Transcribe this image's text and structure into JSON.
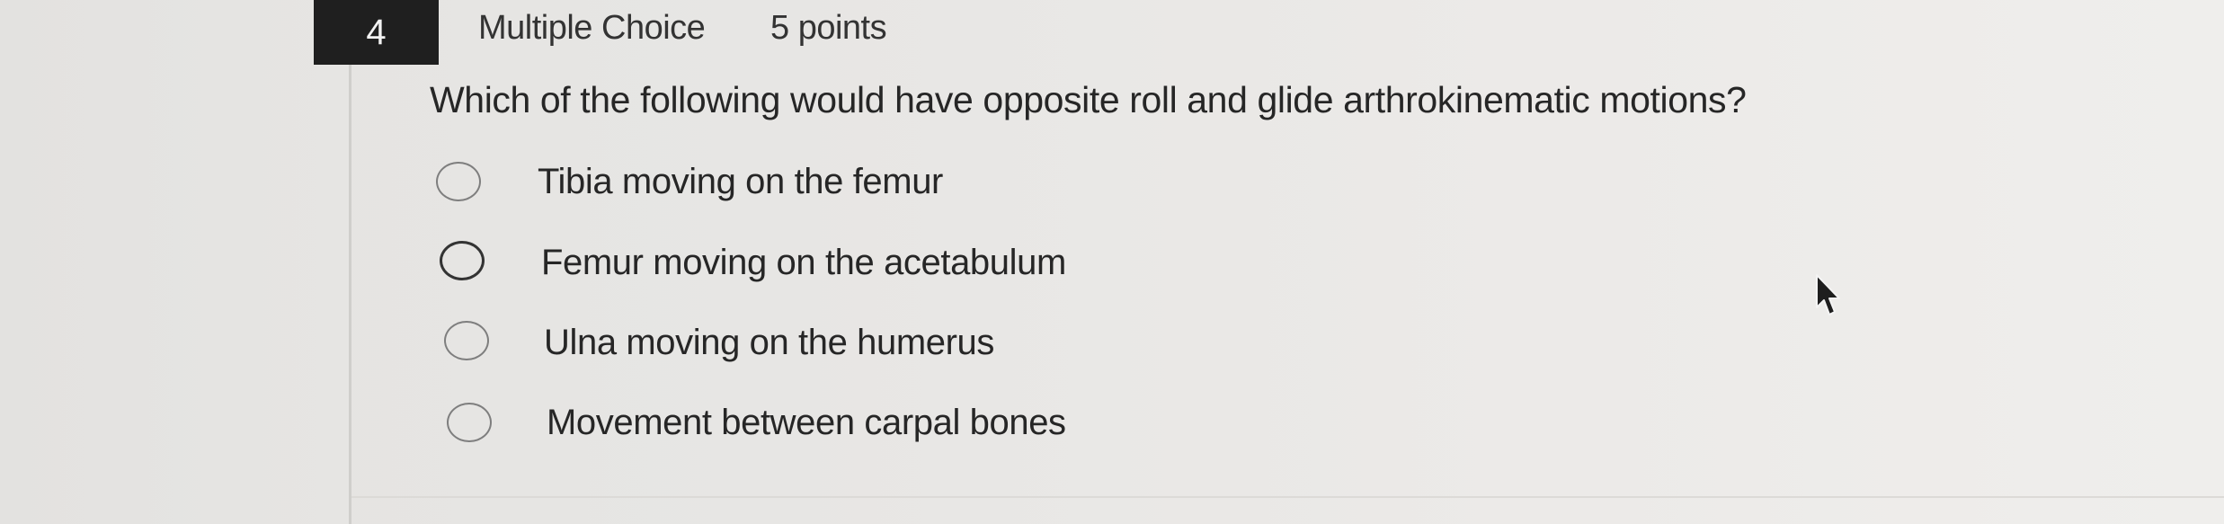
{
  "question": {
    "number": "4",
    "type": "Multiple Choice",
    "points": "5 points",
    "prompt": "Which of the following would have opposite roll and glide arthrokinematic motions?"
  },
  "choices": [
    {
      "label": "Tibia moving on the femur"
    },
    {
      "label": "Femur moving on the acetabulum"
    },
    {
      "label": "Ulna moving on the humerus"
    },
    {
      "label": "Movement between carpal bones"
    }
  ],
  "icons": {
    "radio": "radio-button-icon",
    "cursor": "mouse-pointer-icon"
  },
  "colors": {
    "badge_background": "#1f1f1f",
    "badge_text": "#f2f2f2",
    "text": "#262626",
    "page_background": "#e7e6e4"
  }
}
